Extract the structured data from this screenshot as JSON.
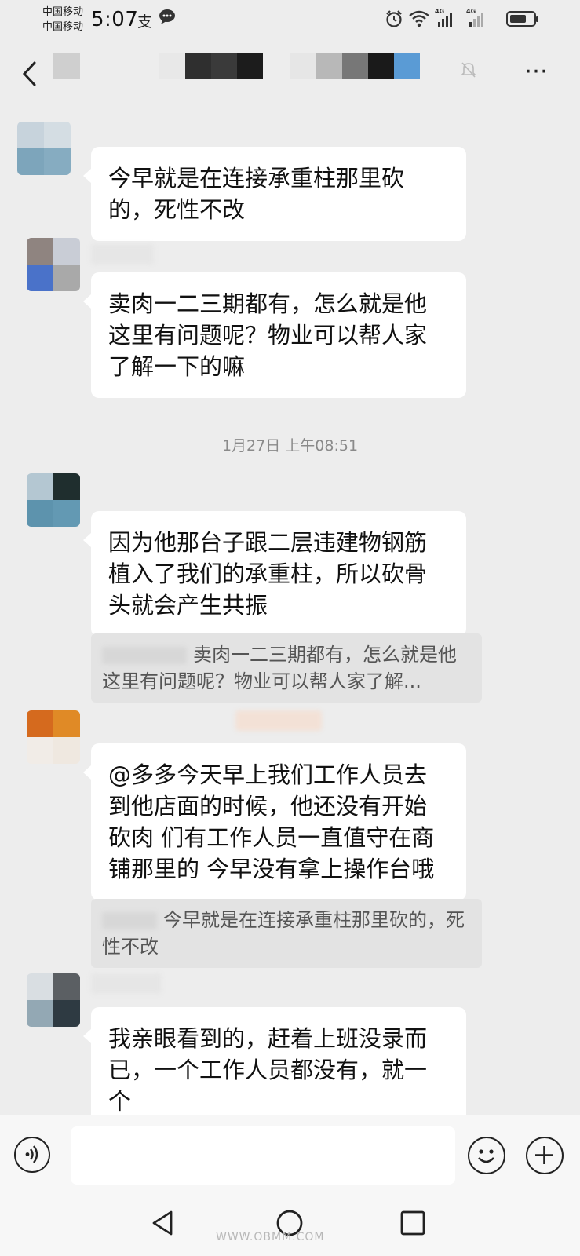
{
  "status_bar": {
    "carrier_1": "中国移动",
    "carrier_2": "中国移动",
    "time": "5:07",
    "network_1": "4G",
    "network_2": "4G"
  },
  "header": {
    "back_icon": "chevron-left-icon",
    "mute_icon": "bell-off-icon",
    "more_icon": "more-horizontal-icon"
  },
  "messages": [
    {
      "text": "今早就是在连接承重柱那里砍的，死性不改"
    },
    {
      "text": "卖肉一二三期都有，怎么就是他这里有问题呢？物业可以帮人家了解一下的嘛"
    },
    {
      "text": "因为他那台子跟二层违建物钢筋植入了我们的承重柱，所以砍骨头就会产生共振",
      "quote": "卖肉一二三期都有，怎么就是他这里有问题呢？物业可以帮人家了解..."
    },
    {
      "text": "@多多今天早上我们工作人员去到他店面的时候，他还没有开始砍肉  们有工作人员一直值守在商铺那里的  今早没有拿上操作台哦",
      "quote": "今早就是在连接承重柱那里砍的，死性不改"
    },
    {
      "text": "我亲眼看到的，赶着上班没录而已，一个工作人员都没有，就一个"
    }
  ],
  "timestamp": "1月27日 上午08:51",
  "input_bar": {
    "voice_icon": "voice-icon",
    "emoji_icon": "emoji-icon",
    "plus_icon": "plus-icon",
    "input_value": ""
  },
  "system_nav": {
    "back_icon": "triangle-back-icon",
    "home_icon": "circle-home-icon",
    "recents_icon": "square-recents-icon"
  },
  "watermark": "WWW.OBMM.COM",
  "colors": {
    "chat_background": "#ededed",
    "bubble": "#ffffff",
    "quote": "#e3e3e3",
    "timestamp": "#8a8a8a"
  }
}
